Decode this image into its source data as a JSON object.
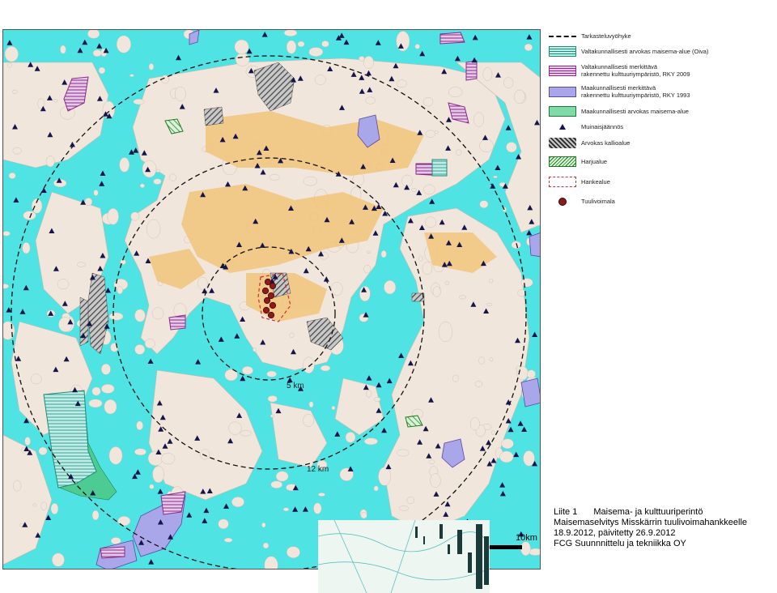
{
  "legend": {
    "items": [
      {
        "id": "tarkastelu",
        "label": "Tarkasteluvyöhyke",
        "symbol": "dashed-line"
      },
      {
        "id": "valtakunnallinen-maisema",
        "label": "Valtakunnallisesti arvokas maisema-alue (Oiva)",
        "symbol": "hatch-teal"
      },
      {
        "id": "rky2009",
        "label": "Valtakunnallisesti merkittävä\nrakennettu kulttuuriympäristö, RKY 2009",
        "symbol": "hatch-purple"
      },
      {
        "id": "rky1993",
        "label": "Maakunnallisesti merkittävä\nrakennettu kulttuuriympäristö, RKY 1993",
        "symbol": "fill-lavender"
      },
      {
        "id": "maakunnallinen-maisema",
        "label": "Maakunnallisesti arvokas maisema-alue",
        "symbol": "fill-green"
      },
      {
        "id": "muinais",
        "label": "Muinaisjäännös",
        "symbol": "triangle"
      },
      {
        "id": "kallio",
        "label": "Arvokas kallioalue",
        "symbol": "hatch-grey"
      },
      {
        "id": "harju",
        "label": "Harjualue",
        "symbol": "hatch-green"
      },
      {
        "id": "hanke",
        "label": "Hankealue",
        "symbol": "dashed-red"
      },
      {
        "id": "tuulivoimala",
        "label": "Tuulivoimala",
        "symbol": "dot-red"
      }
    ]
  },
  "map": {
    "ring_labels": [
      "5 km",
      "12 km"
    ]
  },
  "scale_bar": {
    "label": "10km"
  },
  "caption": {
    "line1_left": "Liite 1",
    "line1_right": "Maisema- ja kulttuuriperintö",
    "line2": "Maisemaselvitys Misskärrin tuulivoimahankkeelle",
    "line3": "18.9.2012, päivitetty 26.9.2012",
    "line4": "FCG Suunnnittelu ja tekniikka OY"
  },
  "colors": {
    "sea": "#4fe3e3",
    "land": "#f1e6dc",
    "urban": "#f2c47a",
    "lavender": "#a9a7ea",
    "purple": "#8a2a8a",
    "green": "#4cc98a",
    "turbine": "#8b1a1a"
  }
}
